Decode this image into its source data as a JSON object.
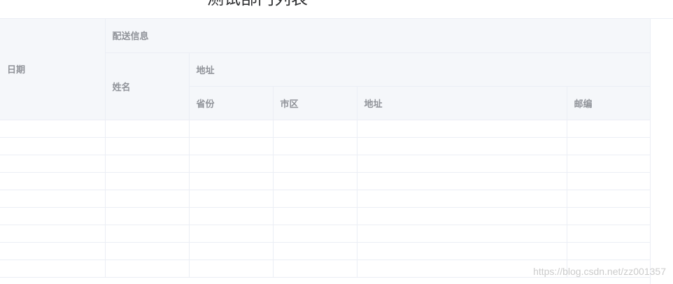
{
  "page": {
    "title": "测试部门列表"
  },
  "table": {
    "headers": {
      "date": "日期",
      "delivery_info": "配送信息",
      "name": "姓名",
      "address_group": "地址",
      "province": "省份",
      "city": "市区",
      "address": "地址",
      "zip": "邮编"
    },
    "rows": [
      {},
      {},
      {},
      {},
      {},
      {},
      {},
      {},
      {}
    ]
  },
  "watermark": "https://blog.csdn.net/zz001357"
}
